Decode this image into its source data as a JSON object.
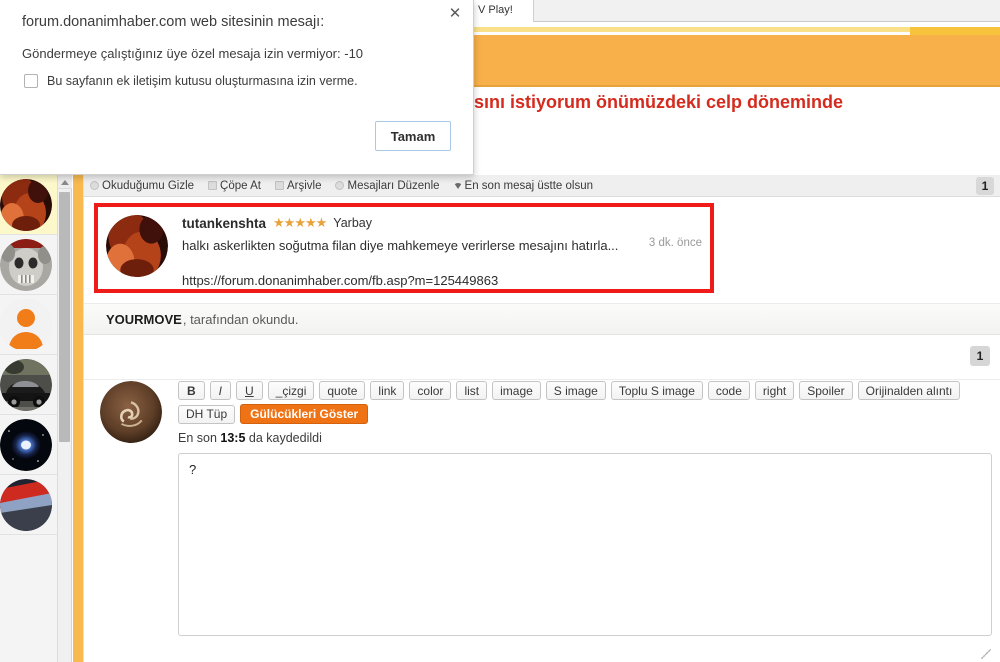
{
  "browser": {
    "tab_label": "V Play!"
  },
  "site": {
    "headline_red": "sını istiyorum önümüzdeki celp döneminde",
    "banner_color": "#f8b04b",
    "headline_color": "#d52b1e",
    "accent_color": "#ef7215"
  },
  "message_toolbar": {
    "items": [
      {
        "label": "Okuduğumu Gizle",
        "icon": "eye-hide-icon"
      },
      {
        "label": "Çöpe At",
        "icon": "trash-icon"
      },
      {
        "label": "Arşivle",
        "icon": "archive-icon"
      },
      {
        "label": "Mesajları Düzenle",
        "icon": "edit-icon"
      },
      {
        "label": "En son mesaj üstte olsun",
        "icon": "arrow-down-icon"
      }
    ],
    "page_badge": "1"
  },
  "post": {
    "username": "tutankenshta",
    "stars": "★★★★★",
    "rank": "Yarbay",
    "body": "halkı askerlikten soğutma filan diye mahkemeye verirlerse mesajını hatırla...",
    "link": "https://forum.donanimhaber.com/fb.asp?m=125449863",
    "time": "3 dk. önce",
    "highlight_color": "#ee1b18",
    "avatar": "woman-portrait-avatar"
  },
  "read_receipt": {
    "user": "YOURMOVE",
    "text": ", tarafından okundu."
  },
  "thread_footer": {
    "page_badge": "1"
  },
  "composer": {
    "avatar": "calligraphy-avatar",
    "bb_buttons": [
      {
        "label": "B",
        "style": "bold"
      },
      {
        "label": "I",
        "style": "italic"
      },
      {
        "label": "U",
        "style": "underline"
      },
      {
        "label": "_çizgi",
        "style": "plain"
      },
      {
        "label": "quote",
        "style": "plain"
      },
      {
        "label": "link",
        "style": "plain"
      },
      {
        "label": "color",
        "style": "plain"
      },
      {
        "label": "list",
        "style": "plain"
      },
      {
        "label": "image",
        "style": "plain"
      },
      {
        "label": "S image",
        "style": "plain"
      },
      {
        "label": "Toplu S image",
        "style": "plain"
      },
      {
        "label": "code",
        "style": "plain"
      },
      {
        "label": "right",
        "style": "plain"
      },
      {
        "label": "Spoiler",
        "style": "plain"
      },
      {
        "label": "Orijinalden alıntı",
        "style": "plain"
      }
    ],
    "bb_buttons_row2": [
      {
        "label": "DH Tüp",
        "style": "plain"
      },
      {
        "label": "Gülücükleri Göster",
        "style": "accent"
      }
    ],
    "saved_prefix": "En son ",
    "saved_time": "13:5",
    "saved_suffix": " da kaydedildi",
    "textarea_value": "?",
    "textarea_placeholder": ""
  },
  "members_rail": {
    "items": [
      {
        "avatar": "woman-portrait-avatar",
        "active": true
      },
      {
        "avatar": "skull-avatar",
        "active": false
      },
      {
        "avatar": "default-user-avatar",
        "active": false
      },
      {
        "avatar": "black-car-avatar",
        "active": false
      },
      {
        "avatar": "nebula-avatar",
        "active": false
      },
      {
        "avatar": "red-flag-avatar",
        "active": false
      }
    ]
  },
  "dialog": {
    "title": "forum.donanimhaber.com web sitesinin mesajı:",
    "message": "Göndermeye çalıştığınız üye özel mesaja izin vermiyor: -10",
    "checkbox_label": "Bu sayfanın ek iletişim kutusu oluşturmasına izin verme.",
    "checkbox_checked": false,
    "ok_label": "Tamam",
    "close_icon": "✕"
  }
}
